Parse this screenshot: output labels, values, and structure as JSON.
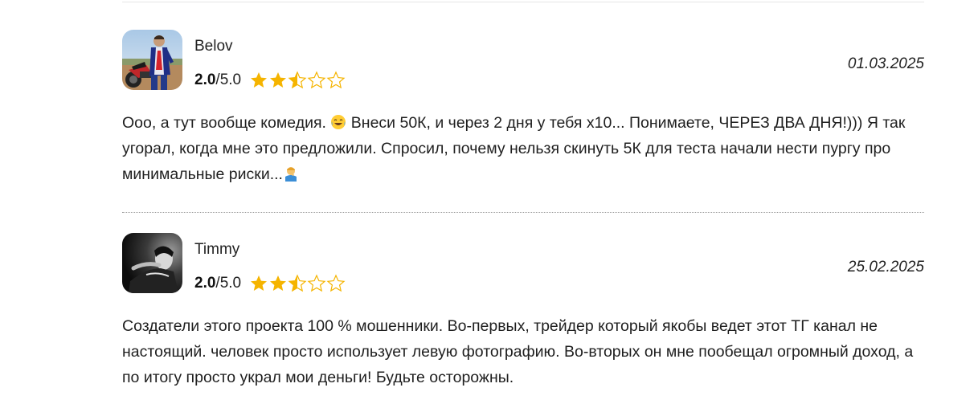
{
  "reviews": [
    {
      "author": "Belov",
      "rating_value": "2.0",
      "rating_max": "/5.0",
      "rating": 2.5,
      "date": "01.03.2025",
      "text_part1": "Ооо, а тут вообще комедия. ",
      "emoji1": "tears-of-joy-emoji",
      "text_part2": " Внеси 50К, и через 2 дня у тебя х10... Понимаете, ЧЕРЕЗ ДВА ДНЯ!))) Я так угорал, когда мне это предложили. Спросил, почему нельзя скинуть 5К для теста начали нести пургу про минимальные риски...",
      "emoji2": "facepalm-emoji",
      "avatar_icon": "motorcycle-rider-photo"
    },
    {
      "author": "Timmy",
      "rating_value": "2.0",
      "rating_max": "/5.0",
      "rating": 2.5,
      "date": "25.02.2025",
      "text": "Создатели этого проекта 100 % мошенники. Во-первых, трейдер который якобы ведет этот ТГ канал не настоящий. человек просто использует левую фотографию. Во-вторых он мне пообещал огромный доход, а по итогу просто украл мои деньги! Будьте осторожны.",
      "avatar_icon": "dark-portrait-photo"
    }
  ],
  "colors": {
    "star_fill": "#f5b400",
    "star_outline": "#f5b400",
    "divider": "#9a9a9a"
  }
}
